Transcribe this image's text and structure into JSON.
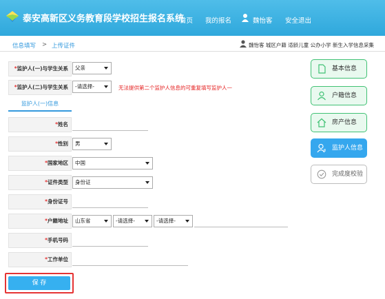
{
  "header": {
    "title": "泰安高新区义务教育段学校招生报名系统",
    "nav": {
      "home": "首页",
      "my_signup": "我的报名",
      "user": "魏怡客",
      "logout": "安全退出"
    }
  },
  "breadcrumb": {
    "step1": "信息填写",
    "separator": ">",
    "step2": "上传证件"
  },
  "user_info": "魏怡客 城区户籍 适龄儿童 公办小学 新生入学信息采集",
  "form": {
    "relation1": {
      "label": "监护人(一)与学生关系",
      "value": "父亲"
    },
    "relation2": {
      "label": "监护人(二)与学生关系",
      "value": "-请选择-"
    },
    "warning": "无法提供第二个监护人信息的可重复填写监护人一",
    "tab": "监护人(一)信息",
    "name": {
      "label": "姓名",
      "value": ""
    },
    "gender": {
      "label": "性别",
      "value": "男"
    },
    "country": {
      "label": "国家地区",
      "value": "中国"
    },
    "id_type": {
      "label": "证件类型",
      "value": "身份证"
    },
    "id_number": {
      "label": "身份证号",
      "value": ""
    },
    "household": {
      "label": "户籍地址",
      "province": "山东省",
      "city": "-请选择-",
      "district": "-请选择-",
      "street": ""
    },
    "phone": {
      "label": "手机号码",
      "value": ""
    },
    "work": {
      "label": "工作单位",
      "value": ""
    },
    "required_mark": "*"
  },
  "side_menu": [
    {
      "label": "基本信息",
      "state": "done",
      "icon": "document-icon"
    },
    {
      "label": "户籍信息",
      "state": "done",
      "icon": "person-icon"
    },
    {
      "label": "房产信息",
      "state": "done",
      "icon": "house-icon"
    },
    {
      "label": "监护人信息",
      "state": "active",
      "icon": "guardian-icon"
    },
    {
      "label": "完成度校验",
      "state": "pending",
      "icon": "check-circle-icon"
    }
  ],
  "save_label": "保 存",
  "colors": {
    "header": "#2fa8dc",
    "accent": "#35a7ee",
    "done_border": "#3fc173",
    "warning": "#e52222"
  }
}
